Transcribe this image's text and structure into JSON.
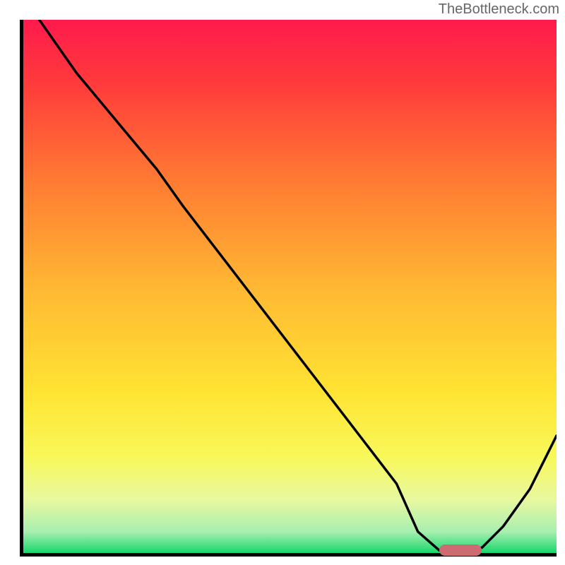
{
  "watermark": "TheBottleneck.com",
  "chart_data": {
    "type": "line",
    "title": "",
    "xlabel": "",
    "ylabel": "",
    "xlim": [
      0,
      100
    ],
    "ylim": [
      0,
      100
    ],
    "series": [
      {
        "name": "curve",
        "x": [
          3,
          10,
          20,
          25,
          30,
          40,
          50,
          60,
          70,
          74,
          78,
          82,
          86,
          90,
          95,
          100
        ],
        "y": [
          100,
          90,
          78,
          72,
          65,
          52,
          39,
          26,
          13,
          4,
          0.5,
          0.5,
          1,
          5,
          12,
          22
        ]
      }
    ],
    "marker": {
      "x_start": 78,
      "x_end": 86,
      "y": 0.5,
      "color": "#cc6b72"
    },
    "background_gradient": {
      "stops": [
        {
          "offset": 0.0,
          "color": "#ff1a4d"
        },
        {
          "offset": 0.12,
          "color": "#ff3b3b"
        },
        {
          "offset": 0.3,
          "color": "#ff7a33"
        },
        {
          "offset": 0.5,
          "color": "#ffb733"
        },
        {
          "offset": 0.7,
          "color": "#ffe433"
        },
        {
          "offset": 0.82,
          "color": "#f8f85a"
        },
        {
          "offset": 0.9,
          "color": "#e8f8a0"
        },
        {
          "offset": 0.96,
          "color": "#a8efb0"
        },
        {
          "offset": 1.0,
          "color": "#17d86b"
        }
      ]
    }
  }
}
